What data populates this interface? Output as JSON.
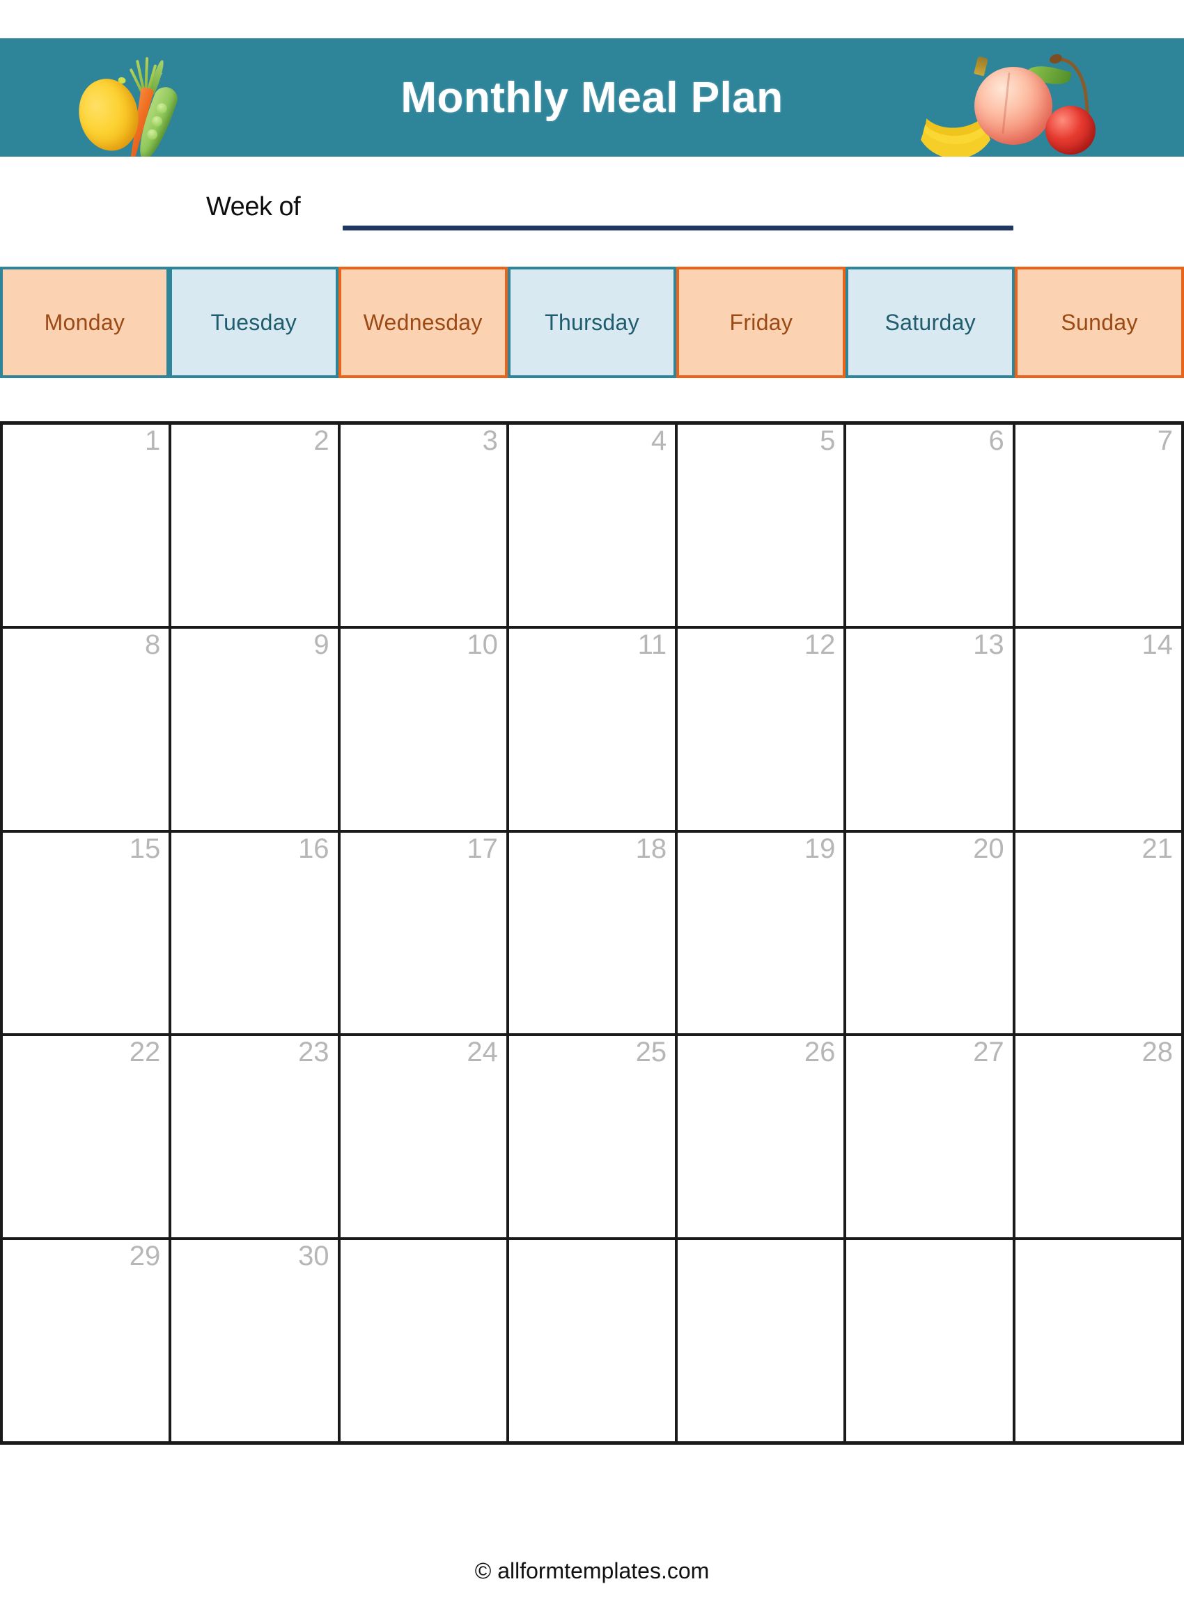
{
  "document": {
    "title": "Monthly Meal Plan",
    "type": "printable-calendar-template"
  },
  "header": {
    "title": "Monthly Meal Plan",
    "background_color": "#2E8499",
    "title_color": "#FFFFFF",
    "left_art": [
      "lemon-icon",
      "carrot-icon",
      "pea-pod-icon"
    ],
    "right_art": [
      "banana-icon",
      "peach-icon",
      "cherry-icon"
    ]
  },
  "week_of": {
    "label": "Week of",
    "value": "",
    "line_color": "#1F3864"
  },
  "day_header": {
    "orange_fill": "#FBD3B2",
    "orange_text": "#9C4A15",
    "orange_border": "#E8641A",
    "blue_fill": "#D9E9F1",
    "blue_text": "#1F5C6E",
    "blue_border": "#2E8499",
    "days": [
      {
        "label": "Monday",
        "style": "orange"
      },
      {
        "label": "Tuesday",
        "style": "blue"
      },
      {
        "label": "Wednesday",
        "style": "orange"
      },
      {
        "label": "Thursday",
        "style": "blue"
      },
      {
        "label": "Friday",
        "style": "orange"
      },
      {
        "label": "Saturday",
        "style": "blue"
      },
      {
        "label": "Sunday",
        "style": "orange"
      }
    ]
  },
  "calendar": {
    "number_color": "#B6B6B6",
    "grid_color": "#1A1A1A",
    "columns": 7,
    "rows": 5,
    "weeks": [
      {
        "days": [
          {
            "number": "1",
            "note": ""
          },
          {
            "number": "2",
            "note": ""
          },
          {
            "number": "3",
            "note": ""
          },
          {
            "number": "4",
            "note": ""
          },
          {
            "number": "5",
            "note": ""
          },
          {
            "number": "6",
            "note": ""
          },
          {
            "number": "7",
            "note": ""
          }
        ]
      },
      {
        "days": [
          {
            "number": "8",
            "note": ""
          },
          {
            "number": "9",
            "note": ""
          },
          {
            "number": "10",
            "note": ""
          },
          {
            "number": "11",
            "note": ""
          },
          {
            "number": "12",
            "note": ""
          },
          {
            "number": "13",
            "note": ""
          },
          {
            "number": "14",
            "note": ""
          }
        ]
      },
      {
        "days": [
          {
            "number": "15",
            "note": ""
          },
          {
            "number": "16",
            "note": ""
          },
          {
            "number": "17",
            "note": ""
          },
          {
            "number": "18",
            "note": ""
          },
          {
            "number": "19",
            "note": ""
          },
          {
            "number": "20",
            "note": ""
          },
          {
            "number": "21",
            "note": ""
          }
        ]
      },
      {
        "days": [
          {
            "number": "22",
            "note": ""
          },
          {
            "number": "23",
            "note": ""
          },
          {
            "number": "24",
            "note": ""
          },
          {
            "number": "25",
            "note": ""
          },
          {
            "number": "26",
            "note": ""
          },
          {
            "number": "27",
            "note": ""
          },
          {
            "number": "28",
            "note": ""
          }
        ]
      },
      {
        "days": [
          {
            "number": "29",
            "note": ""
          },
          {
            "number": "30",
            "note": ""
          },
          {
            "number": "",
            "note": ""
          },
          {
            "number": "",
            "note": ""
          },
          {
            "number": "",
            "note": ""
          },
          {
            "number": "",
            "note": ""
          },
          {
            "number": "",
            "note": ""
          }
        ]
      }
    ]
  },
  "footer": {
    "copyright": "© allformtemplates.com"
  }
}
